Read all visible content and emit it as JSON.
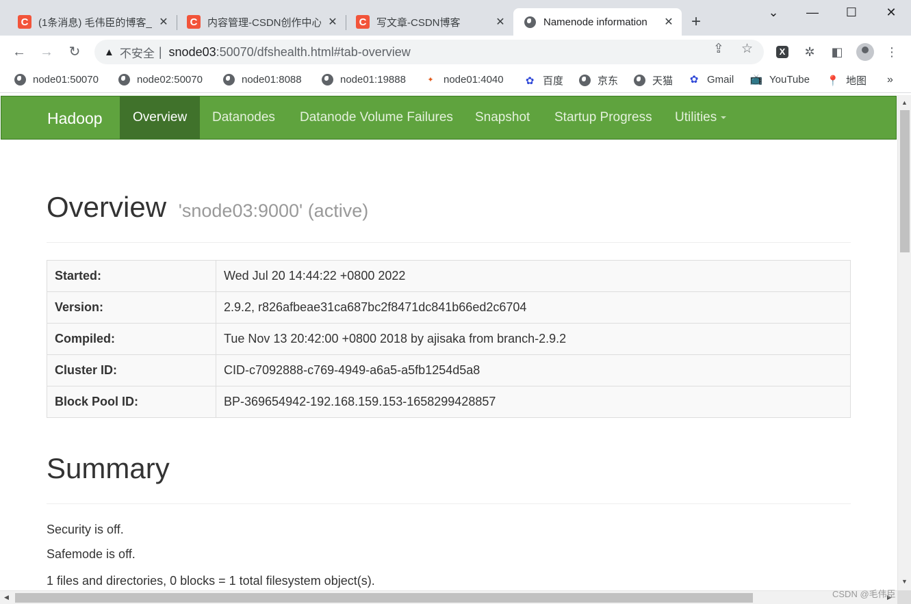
{
  "tabs": [
    {
      "title": "(1条消息) 毛伟臣的博客_",
      "favicon": "C"
    },
    {
      "title": "内容管理-CSDN创作中心",
      "favicon": "C"
    },
    {
      "title": "写文章-CSDN博客",
      "favicon": "C"
    },
    {
      "title": "Namenode information",
      "favicon": "globe-icon"
    }
  ],
  "new_tab": "+",
  "window_controls": {
    "minimize": "—",
    "maximize": "☐",
    "close": "✕",
    "tab_search": "⌄"
  },
  "tab_close": "✕",
  "omnibox": {
    "warning": "▲",
    "not_secure": "不安全",
    "separator": "|",
    "host": "snode03",
    "path": ":50070/dfshealth.html#tab-overview"
  },
  "bookmarks": [
    {
      "label": "node01:50070",
      "icon": "globe-icon"
    },
    {
      "label": "node02:50070",
      "icon": "globe-icon"
    },
    {
      "label": "node01:8088",
      "icon": "globe-icon"
    },
    {
      "label": "node01:19888",
      "icon": "globe-icon"
    },
    {
      "label": "node01:4040",
      "icon": "spark-icon"
    },
    {
      "label": "百度",
      "icon": "baidu-icon"
    },
    {
      "label": "京东",
      "icon": "globe-icon"
    },
    {
      "label": "天猫",
      "icon": "globe-icon"
    },
    {
      "label": "Gmail",
      "icon": "baidu-icon"
    },
    {
      "label": "YouTube",
      "icon": "bilibili-icon"
    },
    {
      "label": "地图",
      "icon": "maps-icon"
    }
  ],
  "bookmarks_more": "»",
  "hadoop_nav": {
    "brand": "Hadoop",
    "items": [
      "Overview",
      "Datanodes",
      "Datanode Volume Failures",
      "Snapshot",
      "Startup Progress",
      "Utilities"
    ],
    "active": "Overview"
  },
  "overview": {
    "title": "Overview",
    "subtitle": "'snode03:9000' (active)",
    "rows": [
      {
        "key": "Started:",
        "value": "Wed Jul 20 14:44:22 +0800 2022"
      },
      {
        "key": "Version:",
        "value": "2.9.2, r826afbeae31ca687bc2f8471dc841b66ed2c6704"
      },
      {
        "key": "Compiled:",
        "value": "Tue Nov 13 20:42:00 +0800 2018 by ajisaka from branch-2.9.2"
      },
      {
        "key": "Cluster ID:",
        "value": "CID-c7092888-c769-4949-a6a5-a5fb1254d5a8"
      },
      {
        "key": "Block Pool ID:",
        "value": "BP-369654942-192.168.159.153-1658299428857"
      }
    ]
  },
  "summary": {
    "title": "Summary",
    "lines": [
      "Security is off.",
      "Safemode is off.",
      "1 files and directories, 0 blocks = 1 total filesystem object(s)."
    ]
  },
  "watermark": "CSDN @毛伟臣",
  "scroll": {
    "up": "▲",
    "down": "▼",
    "left": "◀",
    "right": "▶"
  },
  "colors": {
    "hadoop_green": "#5fa33e",
    "active_nav": "#40722b",
    "csdn_red": "#f2543a"
  }
}
